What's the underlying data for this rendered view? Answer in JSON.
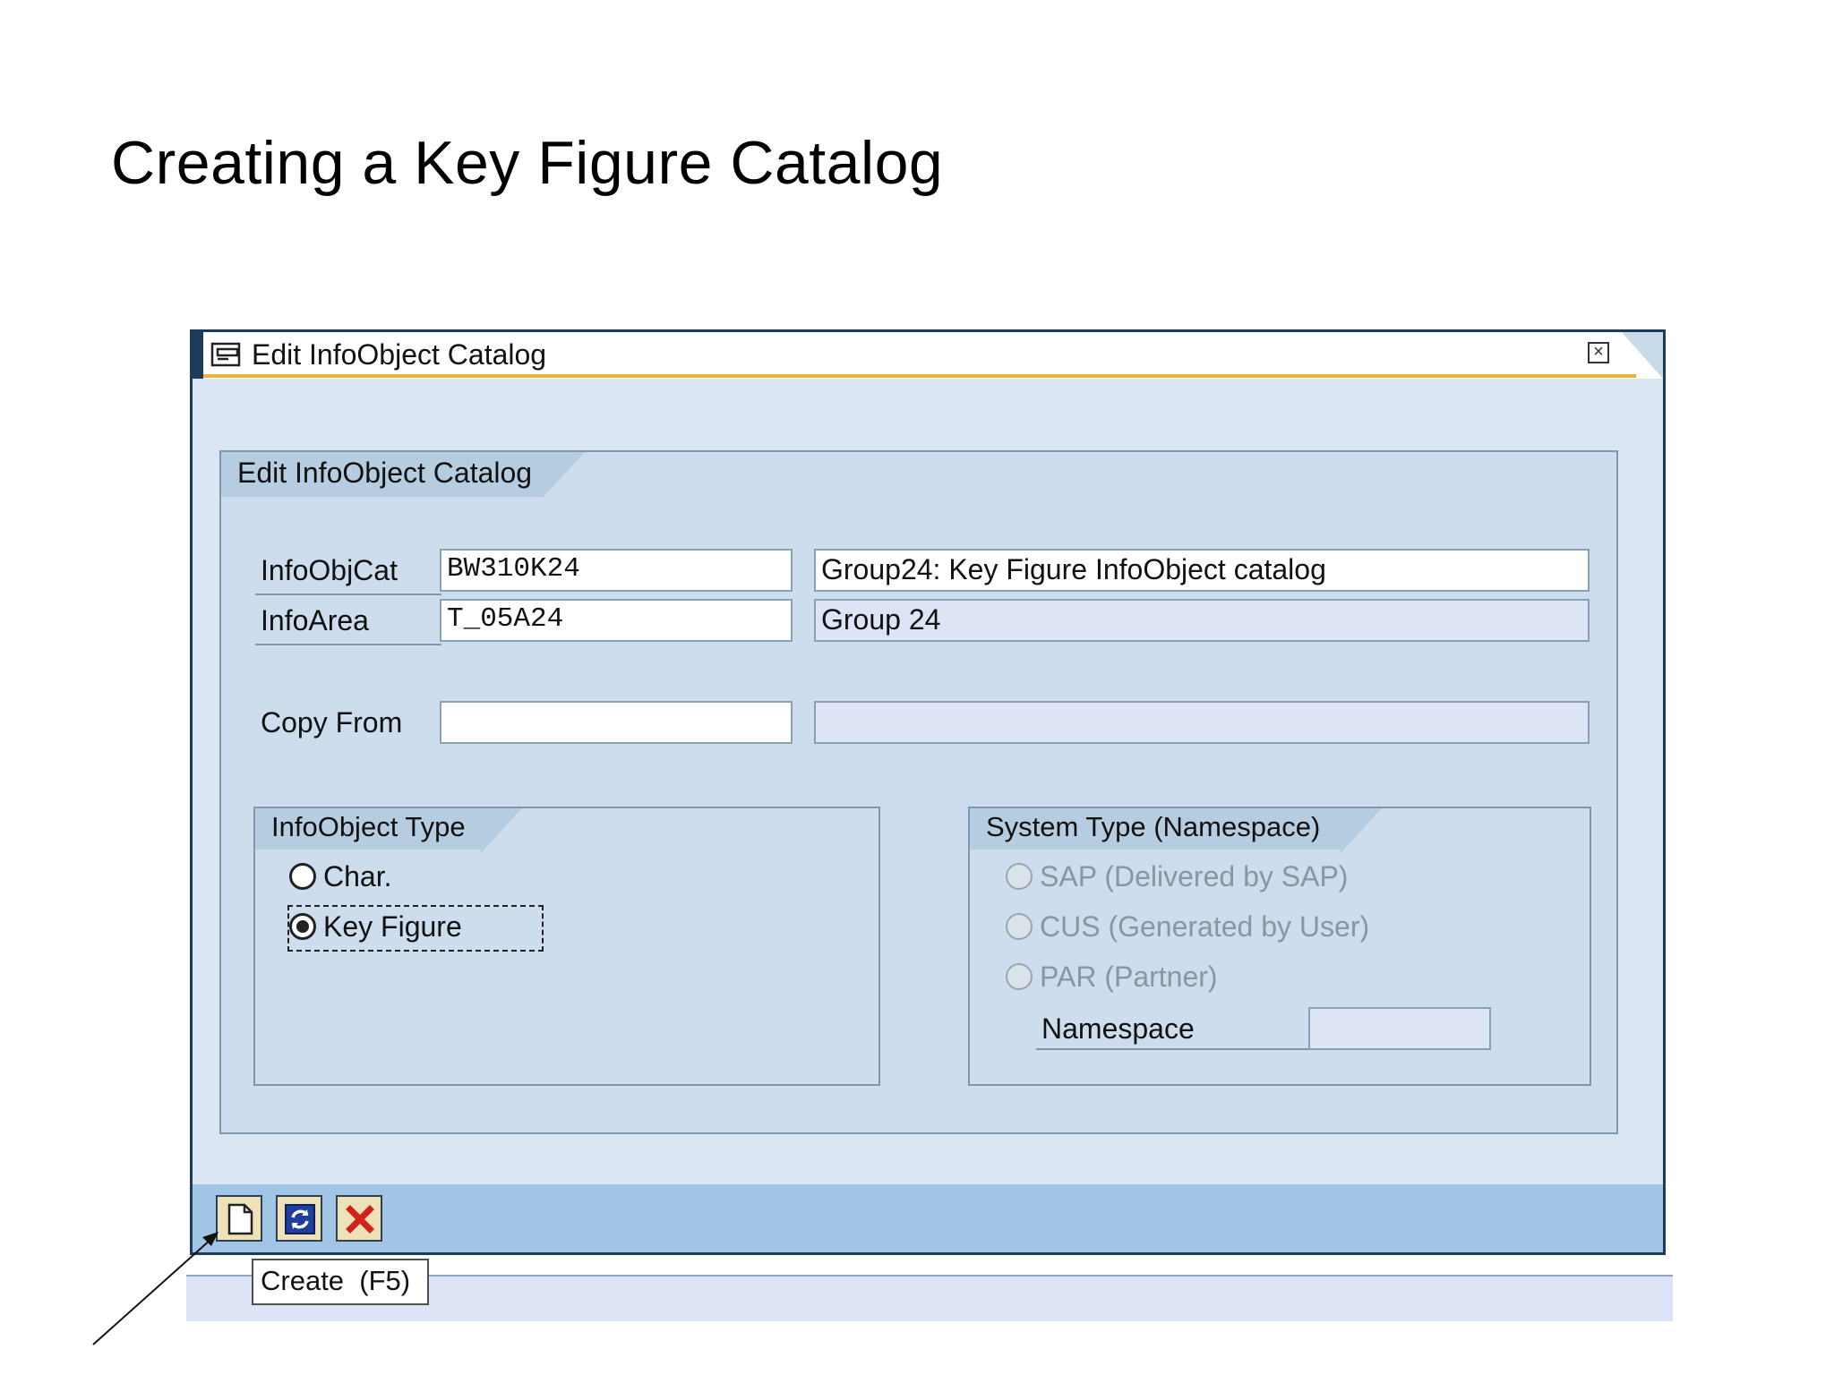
{
  "slide": {
    "title": "Creating a Key Figure Catalog"
  },
  "window": {
    "title": "Edit InfoObject Catalog",
    "close_symbol": "×",
    "group_title": "Edit InfoObject Catalog",
    "fields": {
      "infoobjcat_label": "InfoObjCat",
      "infoobjcat_value": "BW310K24",
      "infoobjcat_desc": "Group24: Key Figure InfoObject catalog",
      "infoarea_label": "InfoArea",
      "infoarea_value": "T_05A24",
      "infoarea_desc": "Group 24",
      "copyfrom_label": "Copy From",
      "copyfrom_value": "",
      "copyfrom_desc": ""
    },
    "infoobject_type": {
      "title": "InfoObject Type",
      "options": [
        {
          "label": "Char.",
          "selected": false
        },
        {
          "label": "Key Figure",
          "selected": true
        }
      ]
    },
    "system_type": {
      "title": "System Type (Namespace)",
      "options": [
        {
          "label": "SAP (Delivered by SAP)",
          "enabled": false
        },
        {
          "label": "CUS (Generated by User)",
          "enabled": false
        },
        {
          "label": "PAR (Partner)",
          "enabled": false
        }
      ],
      "namespace_label": "Namespace",
      "namespace_value": ""
    },
    "toolbar": {
      "buttons": [
        {
          "name": "create",
          "icon": "document-icon"
        },
        {
          "name": "refresh",
          "icon": "refresh-icon"
        },
        {
          "name": "cancel",
          "icon": "cancel-x-icon"
        }
      ]
    }
  },
  "tooltip": {
    "text": "Create  (F5)"
  },
  "colors": {
    "window_border": "#1b3a5c",
    "panel": "#cddded",
    "toolbar": "#a3c5e5",
    "accent": "#e9b33c",
    "cancel_red": "#d0231c"
  }
}
